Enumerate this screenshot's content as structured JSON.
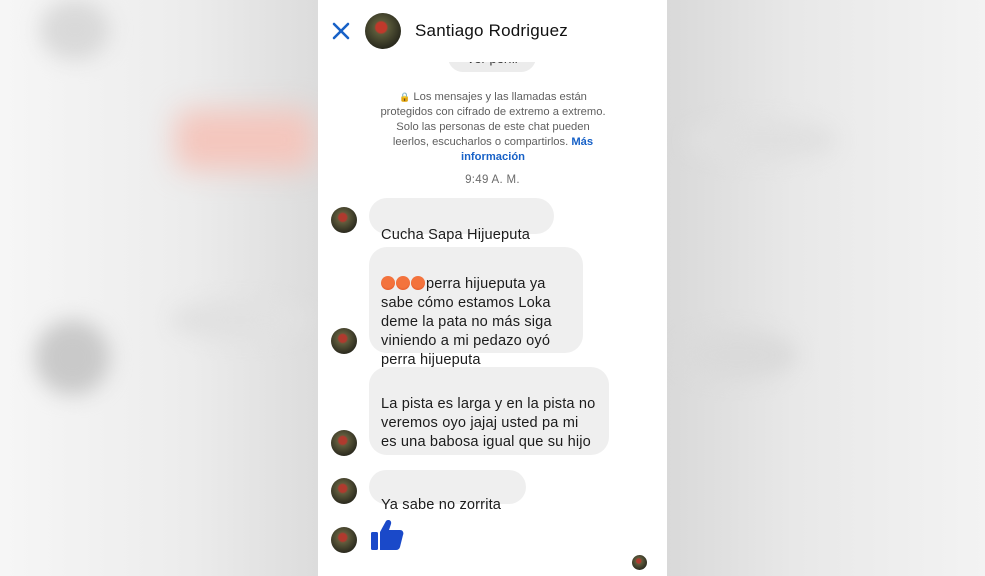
{
  "header": {
    "contact_name": "Santiago Rodriguez",
    "close_icon": "close-icon",
    "view_profile_label": "Ver perfil"
  },
  "notice": {
    "text": "Los mensajes y las llamadas están protegidos con cifrado de extremo a extremo. Solo las personas de este chat pueden leerlos, escucharlos o compartirlos.",
    "link_label": "Más información",
    "icon": "lock-icon"
  },
  "timestamp": "9:49 A. M.",
  "messages": [
    {
      "text": "Cucha Sapa Hijueputa"
    },
    {
      "emoji": "angry-face-emoji x3",
      "text": "perra hijueputa  ya sabe cómo estamos Loka deme la pata no más siga viniendo a mi pedazo oyó perra hijueputa"
    },
    {
      "text": "La pista es larga y en la pista no veremos oyo jajaj usted pa mi es una babosa igual que su hijo"
    },
    {
      "text": "Ya  sabe no zorrita"
    }
  ],
  "like_icon": "thumbs-up-icon",
  "colors": {
    "accent": "#1761c7",
    "bubble_bg": "#efefef",
    "like": "#1a49c9"
  }
}
